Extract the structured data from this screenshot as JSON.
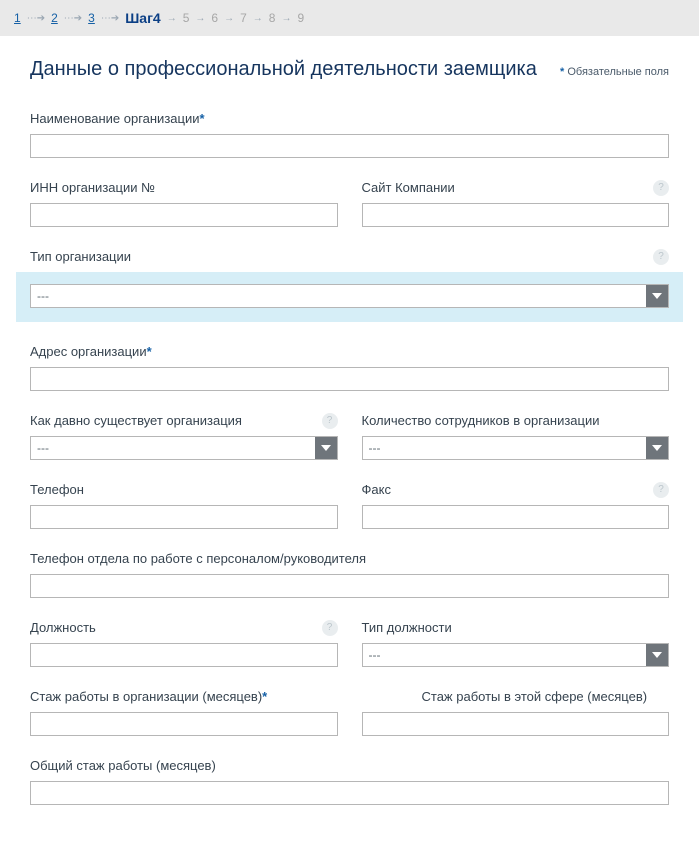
{
  "stepper": {
    "past": [
      "1",
      "2",
      "3"
    ],
    "current": "Шаг4",
    "future": [
      "5",
      "6",
      "7",
      "8",
      "9"
    ]
  },
  "header": {
    "title": "Данные о профессиональной деятельности заемщика",
    "required_note": "Обязательные поля"
  },
  "fields": {
    "org_name": {
      "label": "Наименование организации",
      "required": true
    },
    "inn": {
      "label": "ИНН организации №"
    },
    "website": {
      "label": "Сайт Компании",
      "help": true
    },
    "org_type": {
      "label": "Тип организации",
      "help": true,
      "selected": "---"
    },
    "org_address": {
      "label": "Адрес организации",
      "required": true
    },
    "org_age": {
      "label": "Как давно существует организация",
      "help": true,
      "selected": "---"
    },
    "headcount": {
      "label": "Количество сотрудников в организации",
      "selected": "---"
    },
    "phone": {
      "label": "Телефон"
    },
    "fax": {
      "label": "Факс",
      "help": true
    },
    "hr_phone": {
      "label": "Телефон отдела по работе с персоналом/руководителя"
    },
    "position": {
      "label": "Должность",
      "help": true
    },
    "position_type": {
      "label": "Тип должности",
      "selected": "---"
    },
    "tenure_org": {
      "label": "Стаж работы в организации (месяцев)",
      "required": true
    },
    "tenure_field": {
      "label": "Стаж работы в этой сфере (месяцев)"
    },
    "tenure_total": {
      "label": "Общий стаж работы (месяцев)"
    }
  }
}
